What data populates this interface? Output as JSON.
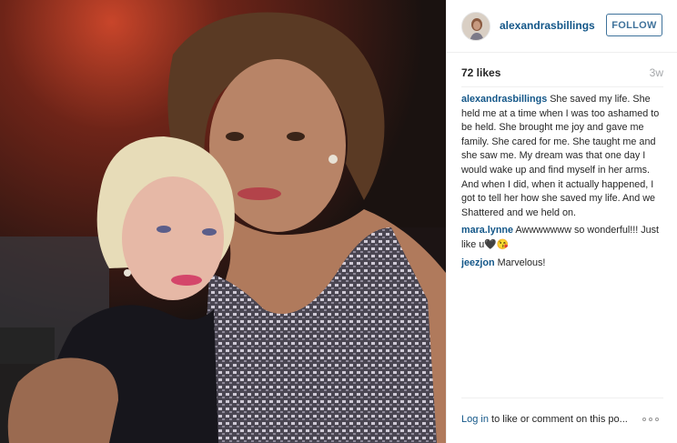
{
  "post": {
    "username": "alexandrasbillings",
    "follow_label": "FOLLOW",
    "likes": "72 likes",
    "age": "3w"
  },
  "comments": [
    {
      "user": "alexandrasbillings",
      "text": "She saved my life. She held me at a time when I was too ashamed to be held. She brought me joy and gave me family. She cared for me. She taught me and she saw me. My dream was that one day I would wake up and find myself in her arms. And when I did, when it actually happened, I got to tell her how she saved my life. And we Shattered and we held on."
    },
    {
      "user": "mara.lynne",
      "text": "Awwwwwww so wonderful!!! Just like u🖤😘"
    },
    {
      "user": "jeezjon",
      "text": "Marvelous!"
    }
  ],
  "footer": {
    "login_label": "Log in",
    "rest": " to like or comment on this po..."
  },
  "icons": {
    "more": "more-options-icon"
  }
}
